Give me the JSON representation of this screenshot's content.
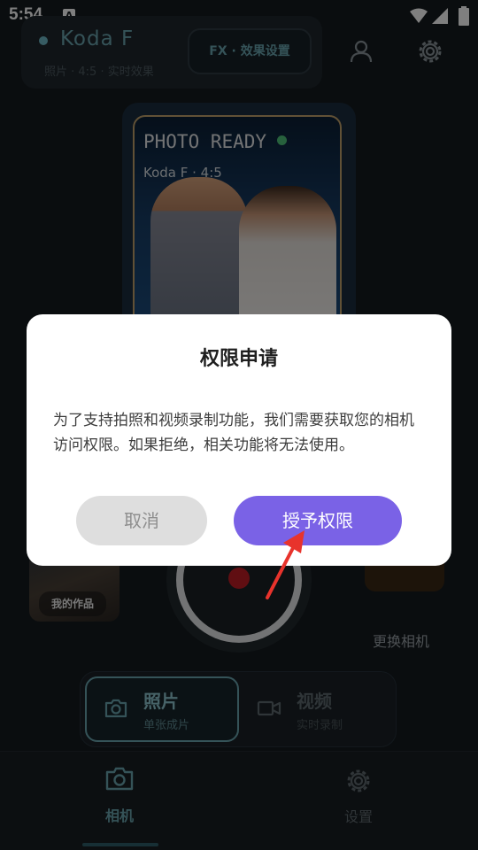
{
  "status_bar": {
    "time": "5:54",
    "notification_icon_letter": "A",
    "icons": [
      "a-icon",
      "wifi-icon",
      "signal-icon",
      "battery-icon"
    ]
  },
  "header": {
    "camera_name": "Koda F",
    "subtitle": "照片 · 4:5 · 实时效果",
    "fx_button_label": "FX · 效果设置",
    "icons": [
      "user-icon",
      "settings-icon"
    ]
  },
  "preview": {
    "status_text": "PHOTO READY",
    "sub_text": "Koda F · 4:5"
  },
  "capture": {
    "gallery_label": "我的作品",
    "switch_camera_label": "更换相机"
  },
  "modes": [
    {
      "label": "照片",
      "sub": "单张成片",
      "icon": "camera-icon",
      "selected": true
    },
    {
      "label": "视频",
      "sub": "实时录制",
      "icon": "video-camera-icon",
      "selected": false
    }
  ],
  "bottom_nav": {
    "items": [
      {
        "label": "相机",
        "icon": "camera-icon",
        "active": true
      },
      {
        "label": "设置",
        "icon": "gear-icon",
        "active": false
      }
    ]
  },
  "dialog": {
    "title": "权限申请",
    "message": "为了支持拍照和视频录制功能，我们需要获取您的相机访问权限。如果拒绝，相关功能将无法使用。",
    "cancel_label": "取消",
    "grant_label": "授予权限"
  },
  "colors": {
    "accent": "#6ba6b1",
    "grant_button": "#7a62e6",
    "record": "#c01d24",
    "annotation_arrow": "#e8332c"
  }
}
